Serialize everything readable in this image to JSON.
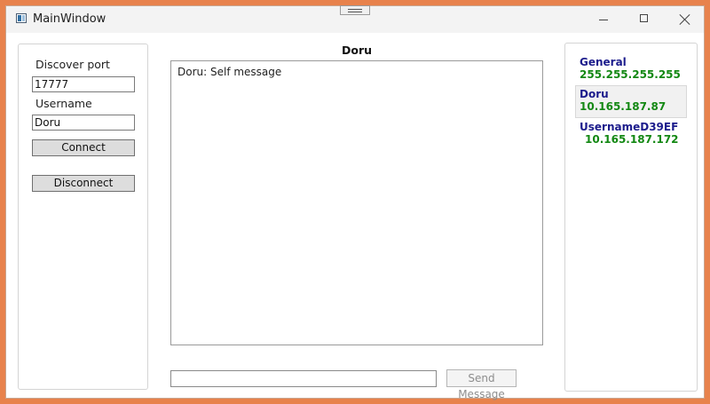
{
  "window": {
    "title": "MainWindow"
  },
  "left_panel": {
    "discover_port_label": "Discover port",
    "discover_port_value": "17777",
    "username_label": "Username",
    "username_value": "Doru",
    "connect_label": "Connect",
    "disconnect_label": "Disconnect"
  },
  "chat": {
    "title": "Doru",
    "messages": [
      "Doru: Self message"
    ],
    "input_value": "",
    "send_label": "Send Message"
  },
  "users": [
    {
      "name": "General",
      "ip": "255.255.255.255",
      "selected": false
    },
    {
      "name": "Doru",
      "ip": "10.165.187.87",
      "selected": true
    },
    {
      "name": "UsernameD39EF",
      "ip": "10.165.187.172",
      "selected": false
    }
  ],
  "colors": {
    "background": "#e8824c",
    "user_name": "#1c1c8c",
    "user_ip": "#138813"
  },
  "icons": [
    "app-icon",
    "drag-grip-icon",
    "minimize-icon",
    "maximize-icon",
    "close-icon"
  ]
}
